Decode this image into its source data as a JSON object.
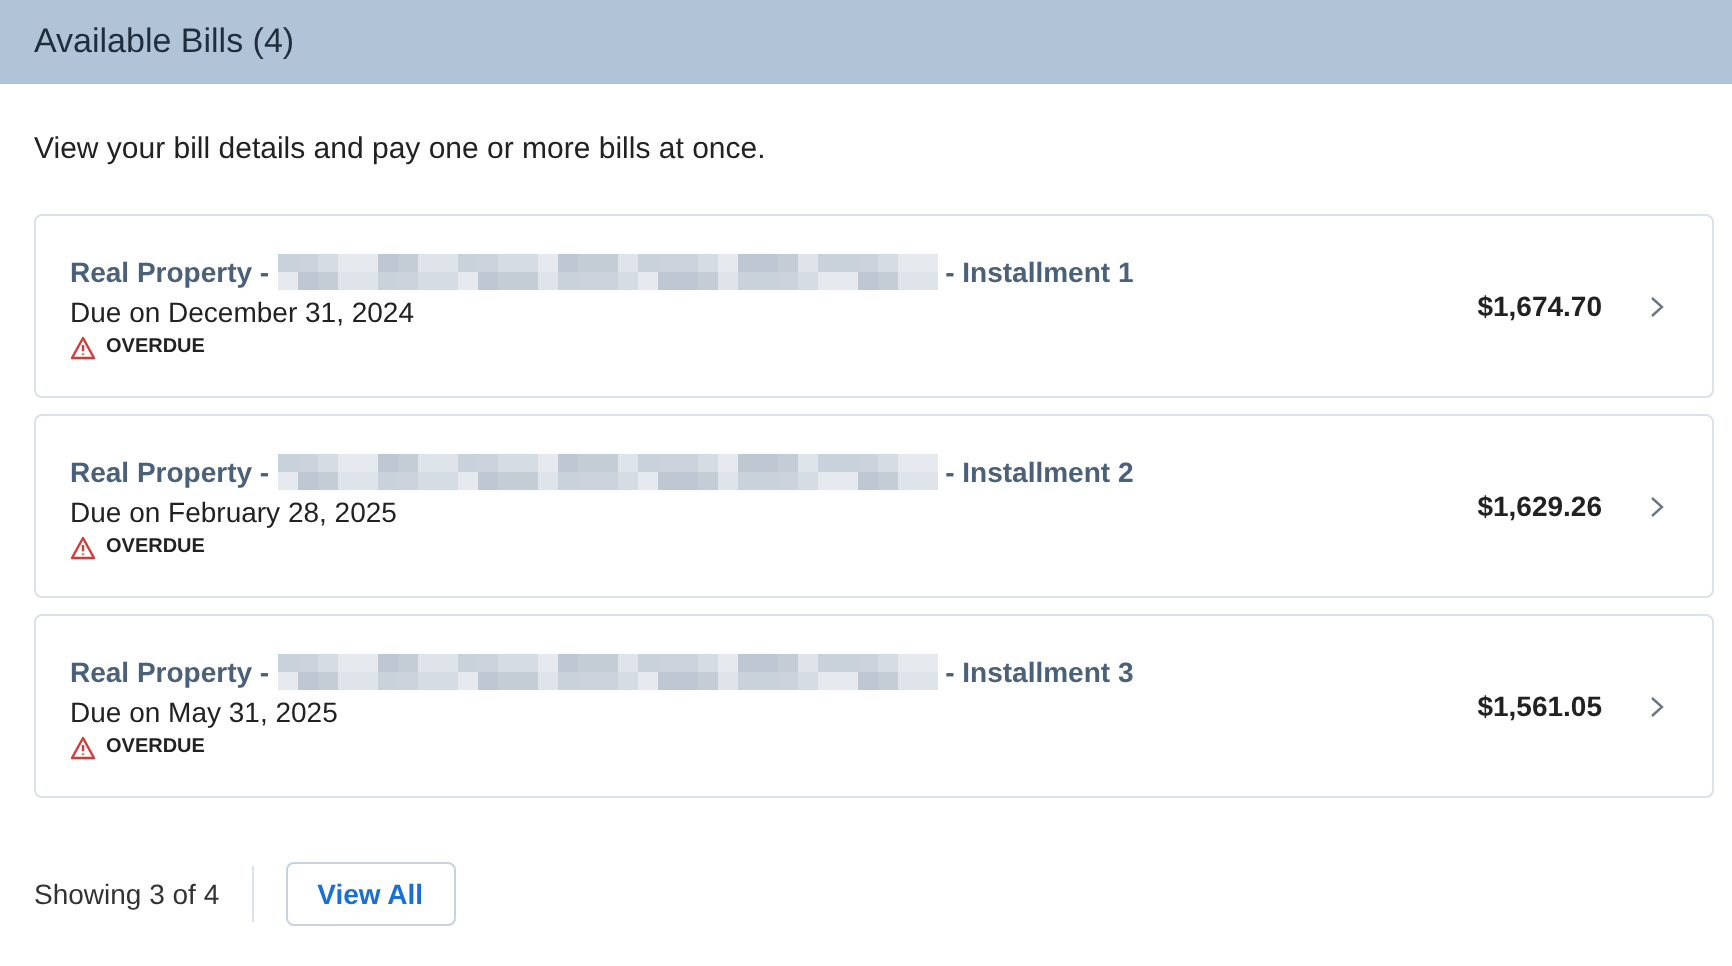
{
  "header": {
    "title": "Available Bills (4)"
  },
  "description": "View your bill details and pay one or more bills at once.",
  "bills": [
    {
      "title_prefix": "Real Property -",
      "redacted": true,
      "title_suffix": "- Installment 1",
      "due": "Due on December 31, 2024",
      "overdue": true,
      "status": "OVERDUE",
      "amount": "$1,674.70"
    },
    {
      "title_prefix": "Real Property -",
      "redacted": true,
      "title_suffix": "- Installment 2",
      "due": "Due on February 28, 2025",
      "overdue": true,
      "status": "OVERDUE",
      "amount": "$1,629.26"
    },
    {
      "title_prefix": "Real Property -",
      "redacted": true,
      "title_suffix": "- Installment 3",
      "due": "Due on May 31, 2025",
      "overdue": true,
      "status": "OVERDUE",
      "amount": "$1,561.05"
    }
  ],
  "footer": {
    "count": "Showing 3 of 4",
    "button": "View All"
  }
}
